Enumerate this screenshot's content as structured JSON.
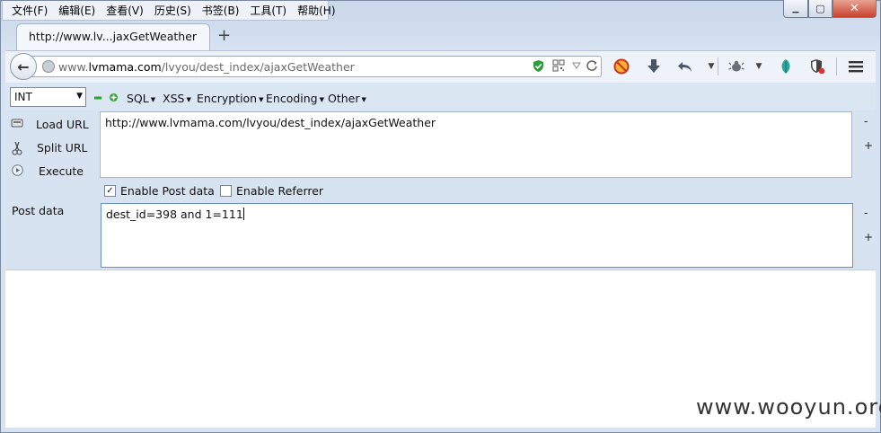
{
  "menubar": [
    "文件(F)",
    "编辑(E)",
    "查看(V)",
    "历史(S)",
    "书签(B)",
    "工具(T)",
    "帮助(H)"
  ],
  "window_controls": {
    "minimize": "▁",
    "maximize": "▢",
    "close": "✕"
  },
  "tab": {
    "title": "http://www.lv...jaxGetWeather",
    "new_tab": "+"
  },
  "address": {
    "host_prefix": "www.",
    "domain": "lvmama.com",
    "path": "/lvyou/dest_index/ajaxGetWeather"
  },
  "hackbar": {
    "int_value": "INT",
    "menus": [
      "SQL",
      "XSS",
      "Encryption",
      "Encoding",
      "Other"
    ],
    "actions": [
      "Load URL",
      "Split URL",
      "Execute"
    ],
    "url": "http://www.lvmama.com/lvyou/dest_index/ajaxGetWeather",
    "enable_post_label": "Enable Post data",
    "enable_post_checked": true,
    "enable_referrer_label": "Enable Referrer",
    "enable_referrer_checked": false,
    "post_label": "Post data",
    "post_data": "dest_id=398 and 1=111",
    "minus": "-",
    "plus": "+"
  },
  "watermark": "www.wooyun.org",
  "colors": {
    "accent_green": "#2aa52a",
    "shield_green": "#2a9d3c",
    "close_red": "#c7422d"
  }
}
